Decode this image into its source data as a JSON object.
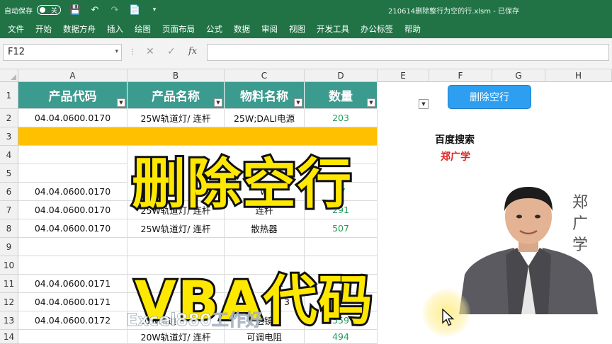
{
  "titlebar": {
    "autosave_label": "自动保存",
    "autosave_state": "关",
    "doc_title": "210614删除整行为空的行.xlsm - 已保存",
    "bg_color": "#217346"
  },
  "ribbon": {
    "tabs": [
      "文件",
      "开始",
      "数据方舟",
      "插入",
      "绘图",
      "页面布局",
      "公式",
      "数据",
      "审阅",
      "视图",
      "开发工具",
      "办公标签",
      "帮助"
    ]
  },
  "formula_bar": {
    "name_box": "F12",
    "fx": "fx",
    "formula": ""
  },
  "columns": [
    "A",
    "B",
    "C",
    "D",
    "E",
    "F",
    "G",
    "H"
  ],
  "rows": [
    "1",
    "2",
    "3",
    "4",
    "5",
    "6",
    "7",
    "8",
    "9",
    "10",
    "11",
    "12",
    "13",
    "14"
  ],
  "table": {
    "headers": [
      "产品代码",
      "产品名称",
      "物料名称",
      "数量"
    ],
    "header_color": "#3b9b8f",
    "highlight_color": "#ffc000",
    "row2": [
      "04.04.0600.0170",
      "25W轨道灯/ 连杆",
      "25W;DALI电源",
      "203"
    ],
    "row6": [
      "04.04.0600.0170",
      "2",
      "W",
      "7"
    ],
    "row7": [
      "04.04.0600.0170",
      "25W轨道灯/ 连杆",
      "连杆",
      "291"
    ],
    "row8": [
      "04.04.0600.0170",
      "25W轨道灯/ 连杆",
      "散热器",
      "507"
    ],
    "row11": [
      "04.04.0600.0171",
      "",
      "A",
      ""
    ],
    "row12": [
      "04.04.0600.0171",
      "道",
      "3",
      ""
    ],
    "row13": [
      "04.04.0600.0172",
      "20W轨道",
      "透镜",
      "559"
    ],
    "row14": [
      "",
      "20W轨道灯/ 连杆",
      "可调电阻",
      "494"
    ]
  },
  "side_panel": {
    "delete_button": "删除空行",
    "search_hint": "百度搜索",
    "author": "郑广学",
    "vertical_name": [
      "郑",
      "广",
      "学"
    ]
  },
  "overlay": {
    "caption_top": "删除空行",
    "caption_bottom": "VBA代码",
    "watermark": "Excel880工作好"
  }
}
